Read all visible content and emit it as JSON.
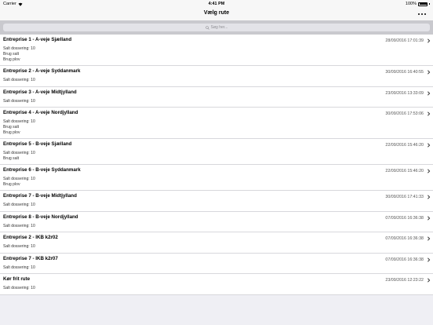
{
  "status": {
    "carrier": "Carrier",
    "time": "4:41 PM",
    "battery": "100%"
  },
  "nav": {
    "title": "Vælg rute"
  },
  "search": {
    "placeholder": "Søg her..."
  },
  "rows": [
    {
      "title": "Entreprise 1 - A-veje Sjælland",
      "date": "28/09/2016 17:01:39",
      "details": [
        "Salt dossering: 10",
        "Brug salt",
        "Brug plov"
      ]
    },
    {
      "title": "Entreprise 2 - A-veje Syddanmark",
      "date": "30/09/2016 16:40:55",
      "details": [
        "Salt dossering: 10"
      ]
    },
    {
      "title": "Entreprise 3 - A-veje Midtjylland",
      "date": "23/09/2016 13:33:09",
      "details": [
        "Salt dossering: 10"
      ]
    },
    {
      "title": "Entreprise 4 - A-veje Nordjylland",
      "date": "30/09/2016 17:53:06",
      "details": [
        "Salt dossering: 10",
        "Brug salt",
        "Brug plov"
      ]
    },
    {
      "title": "Entreprise 5 - B-veje Sjælland",
      "date": "22/09/2016 15:46:20",
      "details": [
        "Salt dossering: 10",
        "Brug salt"
      ]
    },
    {
      "title": "Entreprise 6 - B-veje Syddanmark",
      "date": "22/09/2016 15:46:20",
      "details": [
        "Salt dossering: 10",
        "Brug plov"
      ]
    },
    {
      "title": "Entreprise 7 - B-veje Midtjylland",
      "date": "30/09/2016 17:41:33",
      "details": [
        "Salt dossering: 10"
      ]
    },
    {
      "title": "Entreprise 8 - B-veje Nordjylland",
      "date": "07/09/2016 16:36:38",
      "details": [
        "Salt dossering: 10"
      ]
    },
    {
      "title": "Entreprise 2 - IKB k2r02",
      "date": "07/09/2016 16:36:38",
      "details": [
        "Salt dossering: 10"
      ]
    },
    {
      "title": "Entreprise 7 - IKB k2r07",
      "date": "07/09/2016 16:36:38",
      "details": [
        "Salt dossering: 10"
      ]
    },
    {
      "title": "Kør frit rute",
      "date": "23/09/2016 12:23:22",
      "details": [
        "Salt dossering: 10"
      ]
    }
  ]
}
